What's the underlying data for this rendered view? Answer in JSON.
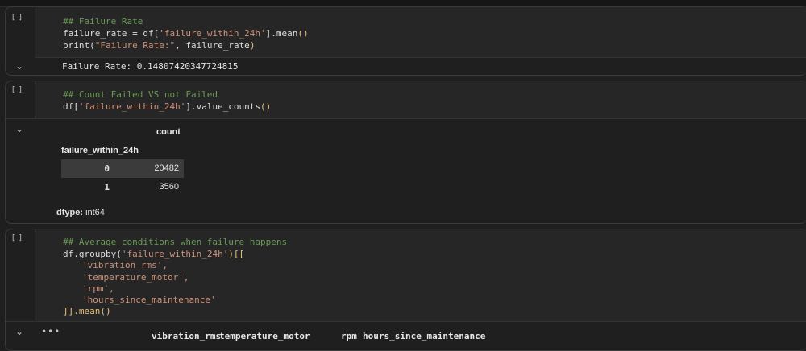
{
  "cells": [
    {
      "gutter": "[ ]",
      "code": {
        "line1": "## Failure Rate",
        "line2_a": "failure_rate = df[",
        "line2_str": "'failure_within_24h'",
        "line2_b": "].mean",
        "line2_paren": "()",
        "line3_a": "print(",
        "line3_str": "\"Failure Rate:\"",
        "line3_b": ", failure_rate",
        "line3_close": ")"
      },
      "output": "Failure Rate: 0.14807420347724815"
    },
    {
      "gutter": "[ ]",
      "code": {
        "line1": "## Count Failed VS not Failed",
        "line2_a": "df[",
        "line2_str": "'failure_within_24h'",
        "line2_b": "].value_counts",
        "line2_paren": "()"
      },
      "output": {
        "column_header": "count",
        "index_name": "failure_within_24h",
        "rows": [
          {
            "index": "0",
            "value": "20482"
          },
          {
            "index": "1",
            "value": "3560"
          }
        ],
        "dtype_label": "dtype:",
        "dtype_value": "int64"
      }
    },
    {
      "gutter": "[ ]",
      "code": {
        "line1": "## Average conditions when failure happens",
        "line2_a": "df.groupby(",
        "line2_str": "'failure_within_24h'",
        "line2_b": ")[[",
        "line3": "'vibration_rms',",
        "line4": "'temperature_motor',",
        "line5": "'rpm',",
        "line6": "'hours_since_maintenance'",
        "line7_a": "]].mean",
        "line7_paren": "()"
      },
      "output": {
        "ellipsis": "•••",
        "columns": [
          "vibration_rms",
          "temperature_motor",
          "rpm",
          "hours_since_maintenance"
        ]
      }
    }
  ]
}
